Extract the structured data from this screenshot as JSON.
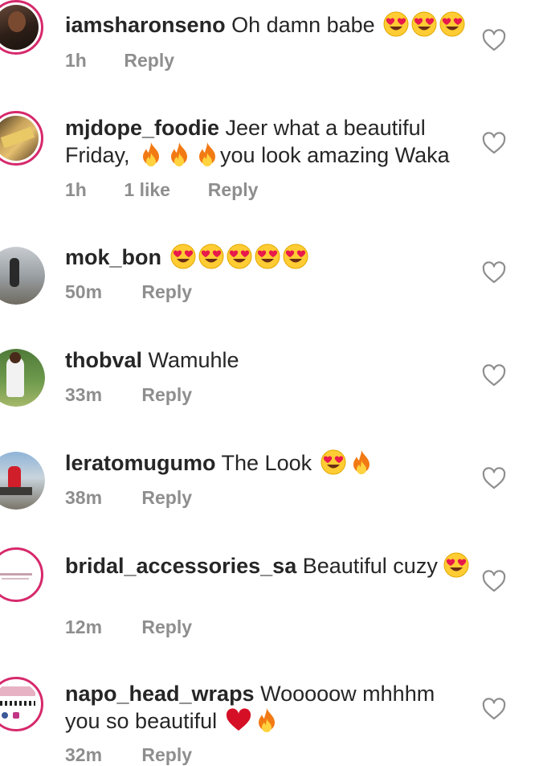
{
  "comments": [
    {
      "username": "iamsharonseno",
      "text": "Oh damn babe",
      "emojis": [
        "heart-eyes",
        "heart-eyes",
        "heart-eyes"
      ],
      "time": "1h",
      "likes": "",
      "reply": "Reply"
    },
    {
      "username": "mjdope_foodie",
      "text": "Jeer what a beautiful Friday,",
      "text2": "you look amazing Waka",
      "emojis": [
        "fire",
        "fire",
        "fire"
      ],
      "time": "1h",
      "likes": "1 like",
      "reply": "Reply"
    },
    {
      "username": "mok_bon",
      "text": "",
      "emojis": [
        "heart-eyes",
        "heart-eyes",
        "heart-eyes",
        "heart-eyes",
        "heart-eyes"
      ],
      "time": "50m",
      "likes": "",
      "reply": "Reply"
    },
    {
      "username": "thobval",
      "text": "Wamuhle",
      "emojis": [],
      "time": "33m",
      "likes": "",
      "reply": "Reply"
    },
    {
      "username": "leratomugumo",
      "text": "The Look",
      "emojis": [
        "heart-eyes",
        "fire"
      ],
      "time": "38m",
      "likes": "",
      "reply": "Reply"
    },
    {
      "username": "bridal_accessories_sa",
      "text": "Beautiful cuzy",
      "emojis": [
        "heart-eyes"
      ],
      "time": "12m",
      "likes": "",
      "reply": "Reply"
    },
    {
      "username": "napo_head_wraps",
      "text": "Wooooow mhhhm you so beautiful",
      "emojis": [
        "red-heart",
        "fire"
      ],
      "time": "32m",
      "likes": "",
      "reply": "Reply"
    }
  ],
  "colors": {
    "username": "#262626",
    "meta": "#8e8e8e",
    "story_ring": "#d6296b"
  }
}
